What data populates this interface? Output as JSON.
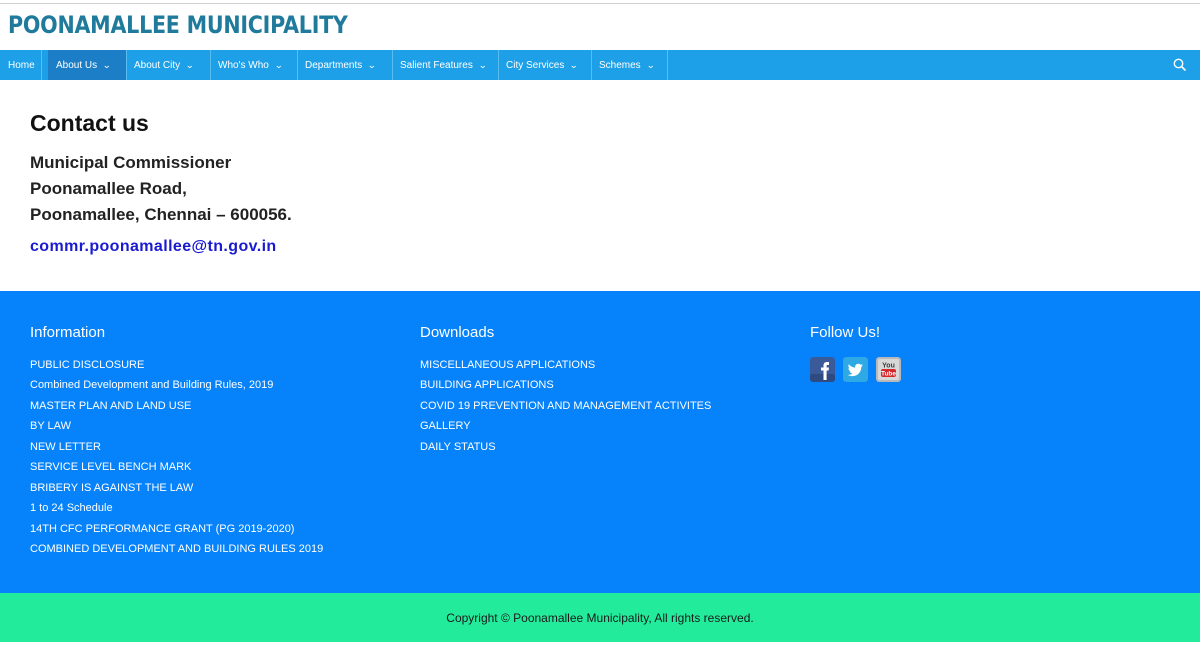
{
  "header": {
    "site_title": "POONAMALLEE MUNICIPALITY"
  },
  "nav": {
    "items": [
      {
        "label": "Home",
        "dropdown": false
      },
      {
        "label": "About Us",
        "dropdown": true,
        "active": true
      },
      {
        "label": "About City",
        "dropdown": true
      },
      {
        "label": "Who's Who",
        "dropdown": true
      },
      {
        "label": "Departments",
        "dropdown": true
      },
      {
        "label": "Salient Features",
        "dropdown": true
      },
      {
        "label": "City Services",
        "dropdown": true
      },
      {
        "label": "Schemes",
        "dropdown": true
      }
    ],
    "search_icon": "search-icon",
    "chevron_glyph": "⌄"
  },
  "main": {
    "heading": "Contact us",
    "address_lines": [
      "Municipal Commissioner",
      "Poonamallee Road,",
      "Poonamallee, Chennai – 600056."
    ],
    "email": "commr.poonamallee@tn.gov.in"
  },
  "footer": {
    "information": {
      "heading": "Information",
      "links": [
        "PUBLIC DISCLOSURE",
        "Combined Development and Building Rules, 2019",
        "MASTER PLAN AND LAND USE",
        "BY LAW",
        "NEW LETTER",
        "SERVICE LEVEL BENCH MARK",
        "BRIBERY IS AGAINST THE LAW",
        "1 to 24 Schedule",
        "14TH CFC PERFORMANCE GRANT (PG 2019-2020)",
        "COMBINED DEVELOPMENT AND BUILDING RULES 2019"
      ]
    },
    "downloads": {
      "heading": "Downloads",
      "links": [
        "MISCELLANEOUS APPLICATIONS",
        "BUILDING APPLICATIONS",
        "COVID 19 PREVENTION AND MANAGEMENT ACTIVITES",
        "GALLERY",
        "DAILY STATUS"
      ]
    },
    "follow": {
      "heading": "Follow Us!",
      "icons": [
        "facebook-icon",
        "twitter-icon",
        "youtube-icon"
      ],
      "youtube_text_top": "You",
      "youtube_text_bottom": "Tube"
    },
    "copyright": "Copyright © Poonamallee Municipality, All rights reserved."
  },
  "colors": {
    "title": "#1f7a9c",
    "nav_bg": "#1ea0e8",
    "nav_active": "#1b7ec7",
    "footer_bg": "#0682fb",
    "copyright_bg": "#22ec9c",
    "email": "#1a1ad0"
  }
}
